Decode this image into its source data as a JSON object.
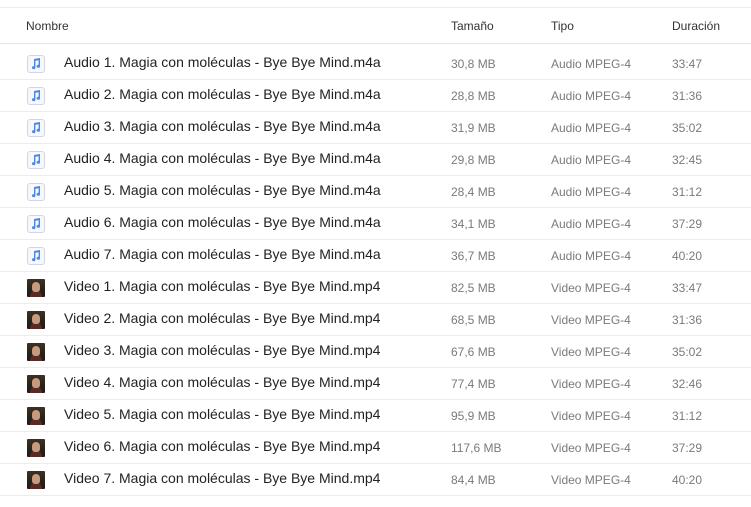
{
  "columns": {
    "name": "Nombre",
    "size": "Tamaño",
    "type": "Tipo",
    "duration": "Duración"
  },
  "files": [
    {
      "kind": "audio",
      "name": "Audio 1. Magia con moléculas - Bye Bye Mind.m4a",
      "size": "30,8 MB",
      "type": "Audio MPEG-4",
      "duration": "33:47"
    },
    {
      "kind": "audio",
      "name": "Audio 2. Magia con moléculas - Bye Bye Mind.m4a",
      "size": "28,8 MB",
      "type": "Audio MPEG-4",
      "duration": "31:36"
    },
    {
      "kind": "audio",
      "name": "Audio 3. Magia con moléculas - Bye Bye Mind.m4a",
      "size": "31,9 MB",
      "type": "Audio MPEG-4",
      "duration": "35:02"
    },
    {
      "kind": "audio",
      "name": "Audio 4. Magia con moléculas - Bye Bye Mind.m4a",
      "size": "29,8 MB",
      "type": "Audio MPEG-4",
      "duration": "32:45"
    },
    {
      "kind": "audio",
      "name": "Audio 5. Magia con moléculas - Bye Bye Mind.m4a",
      "size": "28,4 MB",
      "type": "Audio MPEG-4",
      "duration": "31:12"
    },
    {
      "kind": "audio",
      "name": "Audio 6. Magia con moléculas - Bye Bye Mind.m4a",
      "size": "34,1 MB",
      "type": "Audio MPEG-4",
      "duration": "37:29"
    },
    {
      "kind": "audio",
      "name": "Audio 7. Magia con moléculas - Bye Bye Mind.m4a",
      "size": "36,7 MB",
      "type": "Audio MPEG-4",
      "duration": "40:20"
    },
    {
      "kind": "video",
      "name": "Video 1. Magia con moléculas - Bye Bye Mind.mp4",
      "size": "82,5 MB",
      "type": "Video MPEG-4",
      "duration": "33:47"
    },
    {
      "kind": "video",
      "name": "Video 2. Magia con moléculas - Bye Bye Mind.mp4",
      "size": "68,5 MB",
      "type": "Video MPEG-4",
      "duration": "31:36"
    },
    {
      "kind": "video",
      "name": "Video 3. Magia con moléculas - Bye Bye Mind.mp4",
      "size": "67,6 MB",
      "type": "Video MPEG-4",
      "duration": "35:02"
    },
    {
      "kind": "video",
      "name": "Video 4. Magia con moléculas - Bye Bye Mind.mp4",
      "size": "77,4 MB",
      "type": "Video MPEG-4",
      "duration": "32:46"
    },
    {
      "kind": "video",
      "name": "Video 5. Magia con moléculas - Bye Bye Mind.mp4",
      "size": "95,9 MB",
      "type": "Video MPEG-4",
      "duration": "31:12"
    },
    {
      "kind": "video",
      "name": "Video 6. Magia con moléculas - Bye Bye Mind.mp4",
      "size": "117,6 MB",
      "type": "Video MPEG-4",
      "duration": "37:29"
    },
    {
      "kind": "video",
      "name": "Video 7. Magia con moléculas - Bye Bye Mind.mp4",
      "size": "84,4 MB",
      "type": "Video MPEG-4",
      "duration": "40:20"
    }
  ],
  "icons": {
    "audio": "music-note-icon",
    "video": "video-thumbnail-icon"
  },
  "colors": {
    "audio_note": "#4a86e8",
    "separator": "#ececec",
    "secondary_text": "#7a7a7a"
  }
}
